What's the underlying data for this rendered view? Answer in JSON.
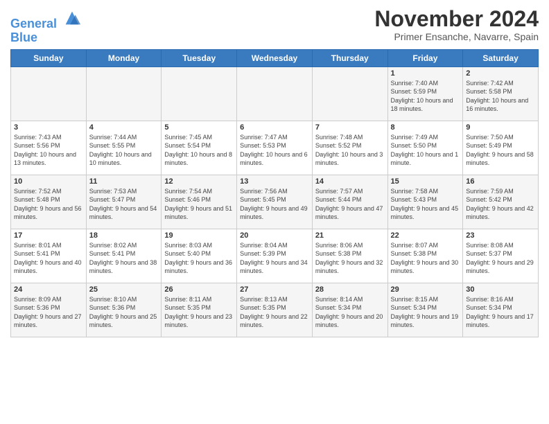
{
  "header": {
    "logo_line1": "General",
    "logo_line2": "Blue",
    "month": "November 2024",
    "location": "Primer Ensanche, Navarre, Spain"
  },
  "days_of_week": [
    "Sunday",
    "Monday",
    "Tuesday",
    "Wednesday",
    "Thursday",
    "Friday",
    "Saturday"
  ],
  "weeks": [
    [
      {
        "day": "",
        "info": ""
      },
      {
        "day": "",
        "info": ""
      },
      {
        "day": "",
        "info": ""
      },
      {
        "day": "",
        "info": ""
      },
      {
        "day": "",
        "info": ""
      },
      {
        "day": "1",
        "info": "Sunrise: 7:40 AM\nSunset: 5:59 PM\nDaylight: 10 hours and 18 minutes."
      },
      {
        "day": "2",
        "info": "Sunrise: 7:42 AM\nSunset: 5:58 PM\nDaylight: 10 hours and 16 minutes."
      }
    ],
    [
      {
        "day": "3",
        "info": "Sunrise: 7:43 AM\nSunset: 5:56 PM\nDaylight: 10 hours and 13 minutes."
      },
      {
        "day": "4",
        "info": "Sunrise: 7:44 AM\nSunset: 5:55 PM\nDaylight: 10 hours and 10 minutes."
      },
      {
        "day": "5",
        "info": "Sunrise: 7:45 AM\nSunset: 5:54 PM\nDaylight: 10 hours and 8 minutes."
      },
      {
        "day": "6",
        "info": "Sunrise: 7:47 AM\nSunset: 5:53 PM\nDaylight: 10 hours and 6 minutes."
      },
      {
        "day": "7",
        "info": "Sunrise: 7:48 AM\nSunset: 5:52 PM\nDaylight: 10 hours and 3 minutes."
      },
      {
        "day": "8",
        "info": "Sunrise: 7:49 AM\nSunset: 5:50 PM\nDaylight: 10 hours and 1 minute."
      },
      {
        "day": "9",
        "info": "Sunrise: 7:50 AM\nSunset: 5:49 PM\nDaylight: 9 hours and 58 minutes."
      }
    ],
    [
      {
        "day": "10",
        "info": "Sunrise: 7:52 AM\nSunset: 5:48 PM\nDaylight: 9 hours and 56 minutes."
      },
      {
        "day": "11",
        "info": "Sunrise: 7:53 AM\nSunset: 5:47 PM\nDaylight: 9 hours and 54 minutes."
      },
      {
        "day": "12",
        "info": "Sunrise: 7:54 AM\nSunset: 5:46 PM\nDaylight: 9 hours and 51 minutes."
      },
      {
        "day": "13",
        "info": "Sunrise: 7:56 AM\nSunset: 5:45 PM\nDaylight: 9 hours and 49 minutes."
      },
      {
        "day": "14",
        "info": "Sunrise: 7:57 AM\nSunset: 5:44 PM\nDaylight: 9 hours and 47 minutes."
      },
      {
        "day": "15",
        "info": "Sunrise: 7:58 AM\nSunset: 5:43 PM\nDaylight: 9 hours and 45 minutes."
      },
      {
        "day": "16",
        "info": "Sunrise: 7:59 AM\nSunset: 5:42 PM\nDaylight: 9 hours and 42 minutes."
      }
    ],
    [
      {
        "day": "17",
        "info": "Sunrise: 8:01 AM\nSunset: 5:41 PM\nDaylight: 9 hours and 40 minutes."
      },
      {
        "day": "18",
        "info": "Sunrise: 8:02 AM\nSunset: 5:41 PM\nDaylight: 9 hours and 38 minutes."
      },
      {
        "day": "19",
        "info": "Sunrise: 8:03 AM\nSunset: 5:40 PM\nDaylight: 9 hours and 36 minutes."
      },
      {
        "day": "20",
        "info": "Sunrise: 8:04 AM\nSunset: 5:39 PM\nDaylight: 9 hours and 34 minutes."
      },
      {
        "day": "21",
        "info": "Sunrise: 8:06 AM\nSunset: 5:38 PM\nDaylight: 9 hours and 32 minutes."
      },
      {
        "day": "22",
        "info": "Sunrise: 8:07 AM\nSunset: 5:38 PM\nDaylight: 9 hours and 30 minutes."
      },
      {
        "day": "23",
        "info": "Sunrise: 8:08 AM\nSunset: 5:37 PM\nDaylight: 9 hours and 29 minutes."
      }
    ],
    [
      {
        "day": "24",
        "info": "Sunrise: 8:09 AM\nSunset: 5:36 PM\nDaylight: 9 hours and 27 minutes."
      },
      {
        "day": "25",
        "info": "Sunrise: 8:10 AM\nSunset: 5:36 PM\nDaylight: 9 hours and 25 minutes."
      },
      {
        "day": "26",
        "info": "Sunrise: 8:11 AM\nSunset: 5:35 PM\nDaylight: 9 hours and 23 minutes."
      },
      {
        "day": "27",
        "info": "Sunrise: 8:13 AM\nSunset: 5:35 PM\nDaylight: 9 hours and 22 minutes."
      },
      {
        "day": "28",
        "info": "Sunrise: 8:14 AM\nSunset: 5:34 PM\nDaylight: 9 hours and 20 minutes."
      },
      {
        "day": "29",
        "info": "Sunrise: 8:15 AM\nSunset: 5:34 PM\nDaylight: 9 hours and 19 minutes."
      },
      {
        "day": "30",
        "info": "Sunrise: 8:16 AM\nSunset: 5:34 PM\nDaylight: 9 hours and 17 minutes."
      }
    ]
  ]
}
